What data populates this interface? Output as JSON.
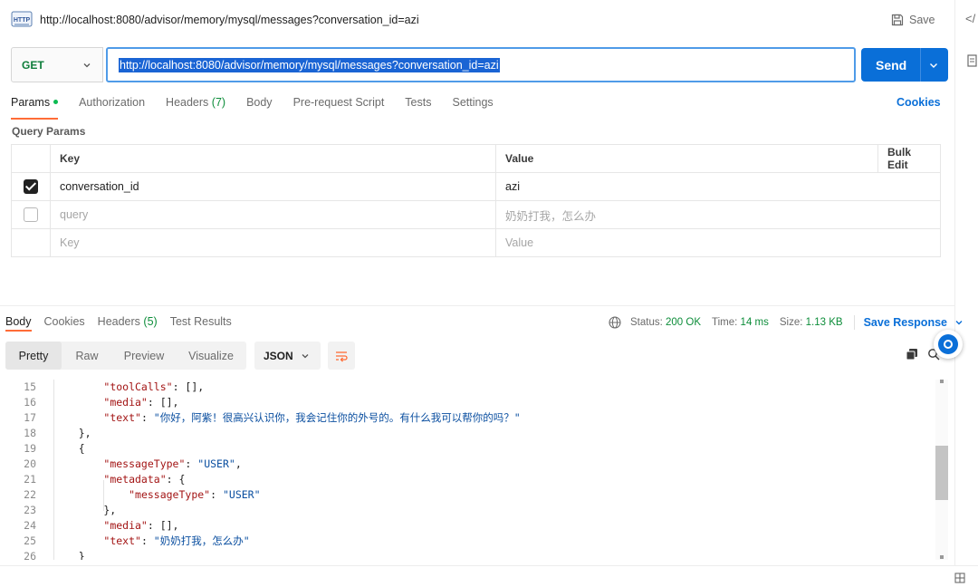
{
  "request": {
    "title": "http://localhost:8080/advisor/memory/mysql/messages?conversation_id=azi",
    "save_label": "Save",
    "method": "GET",
    "url": "http://localhost:8080/advisor/memory/mysql/messages?conversation_id=azi",
    "send_label": "Send",
    "http_icon_text": "HTTP"
  },
  "request_tabs": {
    "params": "Params",
    "authorization": "Authorization",
    "headers": "Headers",
    "headers_count": "(7)",
    "body": "Body",
    "prerequest": "Pre-request Script",
    "tests": "Tests",
    "settings": "Settings",
    "cookies": "Cookies"
  },
  "query_params": {
    "label": "Query Params",
    "columns": {
      "key": "Key",
      "value": "Value",
      "bulk_edit": "Bulk Edit"
    },
    "rows": [
      {
        "checked": true,
        "key": "conversation_id",
        "value": "azi"
      },
      {
        "checked": false,
        "key": "query",
        "value": "奶奶打我，怎么办"
      }
    ],
    "placeholder": {
      "key": "Key",
      "value": "Value"
    }
  },
  "response_tabs": {
    "body": "Body",
    "cookies": "Cookies",
    "headers": "Headers",
    "headers_count": "(5)",
    "test_results": "Test Results"
  },
  "response_meta": {
    "status_label": "Status:",
    "status_value": "200 OK",
    "time_label": "Time:",
    "time_value": "14 ms",
    "size_label": "Size:",
    "size_value": "1.13 KB",
    "save_response": "Save Response"
  },
  "view_modes": [
    "Pretty",
    "Raw",
    "Preview",
    "Visualize"
  ],
  "format": "JSON",
  "code_lines": [
    {
      "n": "15",
      "parts": [
        [
          "p",
          "        "
        ],
        [
          "k",
          "\"toolCalls\""
        ],
        [
          "p",
          ": [],"
        ]
      ]
    },
    {
      "n": "16",
      "parts": [
        [
          "p",
          "        "
        ],
        [
          "k",
          "\"media\""
        ],
        [
          "p",
          ": [],"
        ]
      ]
    },
    {
      "n": "17",
      "parts": [
        [
          "p",
          "        "
        ],
        [
          "k",
          "\"text\""
        ],
        [
          "p",
          ": "
        ],
        [
          "s",
          "\"你好，阿紫！很高兴认识你，我会记住你的外号的。有什么我可以帮你的吗？\""
        ]
      ]
    },
    {
      "n": "18",
      "parts": [
        [
          "p",
          "    },"
        ]
      ]
    },
    {
      "n": "19",
      "parts": [
        [
          "p",
          "    {"
        ]
      ]
    },
    {
      "n": "20",
      "parts": [
        [
          "p",
          "        "
        ],
        [
          "k",
          "\"messageType\""
        ],
        [
          "p",
          ": "
        ],
        [
          "s",
          "\"USER\""
        ],
        [
          "p",
          ","
        ]
      ]
    },
    {
      "n": "21",
      "parts": [
        [
          "p",
          "        "
        ],
        [
          "k",
          "\"metadata\""
        ],
        [
          "p",
          ": {"
        ]
      ]
    },
    {
      "n": "22",
      "parts": [
        [
          "p",
          "            "
        ],
        [
          "k",
          "\"messageType\""
        ],
        [
          "p",
          ": "
        ],
        [
          "s",
          "\"USER\""
        ]
      ]
    },
    {
      "n": "23",
      "parts": [
        [
          "p",
          "        },"
        ]
      ]
    },
    {
      "n": "24",
      "parts": [
        [
          "p",
          "        "
        ],
        [
          "k",
          "\"media\""
        ],
        [
          "p",
          ": [],"
        ]
      ]
    },
    {
      "n": "25",
      "parts": [
        [
          "p",
          "        "
        ],
        [
          "k",
          "\"text\""
        ],
        [
          "p",
          ": "
        ],
        [
          "s",
          "\"奶奶打我，怎么办\""
        ]
      ]
    },
    {
      "n": "26",
      "parts": [
        [
          "p",
          "    }"
        ]
      ]
    }
  ],
  "colors": {
    "send": "#0a6fd8",
    "active_tab": "#ff6c37",
    "status_ok": "#0d8d3a",
    "json_key": "#a31515",
    "json_string": "#0b4fa0"
  }
}
